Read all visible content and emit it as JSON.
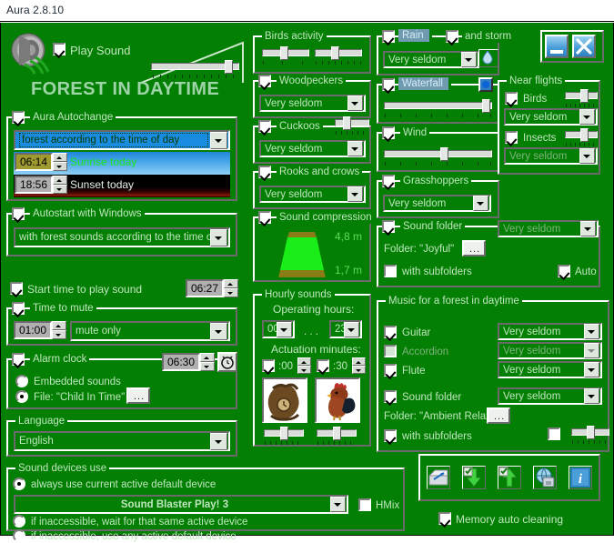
{
  "window": {
    "title": "Aura 2.8.10",
    "minimize_icon": "minimize-icon",
    "close_icon": "close-icon"
  },
  "header": {
    "play_sound_label": "Play Sound",
    "preset_title": "FOREST IN DAYTIME",
    "speaker_icon": "speaker-icon"
  },
  "aura_autochange": {
    "caption": "Aura Autochange",
    "mode_value": "forest according to the time of day",
    "sunrise_time": "06:14",
    "sunrise_label": "Sunrise today",
    "sunset_time": "18:56",
    "sunset_label": "Sunset today"
  },
  "autostart": {
    "caption": "Autostart with Windows",
    "value": "with forest sounds according to the time of day"
  },
  "start_time": {
    "label": "Start time to play sound",
    "value": "06:27"
  },
  "time_to_mute": {
    "caption": "Time to mute",
    "duration": "01:00",
    "mode": "mute only"
  },
  "alarm_clock": {
    "caption": "Alarm clock",
    "time": "06:30",
    "clock_icon": "alarm-clock-icon",
    "option_embedded": "Embedded sounds",
    "option_file": "File: \"Child In Time\"",
    "browse_icon": "browse-dots-icon"
  },
  "language": {
    "caption": "Language",
    "value": "English"
  },
  "sound_devices": {
    "caption": "Sound devices use",
    "option_always": "always use current active default device",
    "device": "Sound Blaster Play! 3",
    "hmix_label": "HMix",
    "option_wait": "if inaccessible, wait for that same active device",
    "option_any": "if inaccessible, use any active default device"
  },
  "birds_activity": {
    "caption": "Birds activity"
  },
  "woodpeckers": {
    "caption": "Woodpeckers",
    "value": "Very seldom"
  },
  "cuckoos": {
    "caption": "Cuckoos",
    "value": "Very seldom"
  },
  "rooks": {
    "caption": "Rooks and crows",
    "value": "Very seldom"
  },
  "sound_compression": {
    "caption": "Sound compression",
    "top_value": "4,8 m",
    "bottom_value": "1,7 m"
  },
  "hourly_sounds": {
    "caption": "Hourly sounds",
    "operating_hours_label": "Operating hours:",
    "hour_from": "00",
    "hours_sep": ". . .",
    "hour_to": "23",
    "actuation_label": "Actuation minutes:",
    "minute_00": ":00",
    "minute_30": ":30",
    "image_left": "cuckoo-clock-image",
    "image_right": "rooster-image"
  },
  "rain": {
    "caption": "Rain",
    "and_storm_label": "and storm",
    "value": "Very seldom",
    "drop_icon": "water-drop-icon"
  },
  "waterfall": {
    "caption": "Waterfall",
    "button_icon": "waterfall-dot-button"
  },
  "wind": {
    "caption": "Wind"
  },
  "grasshoppers": {
    "caption": "Grasshoppers",
    "value": "Very seldom"
  },
  "sound_folder_mid": {
    "caption": "Sound folder",
    "folder_label": "Folder: \"Joyful\"",
    "browse_icon": "browse-dots-icon",
    "subfolders_label": "with subfolders",
    "value": "Very seldom",
    "auto_label": "Auto"
  },
  "near_flights": {
    "caption": "Near flights",
    "birds_label": "Birds",
    "birds_value": "Very seldom",
    "insects_label": "Insects",
    "insects_value": "Very seldom"
  },
  "music": {
    "caption": "Music for a forest in daytime",
    "guitar_label": "Guitar",
    "guitar_value": "Very seldom",
    "accordion_label": "Accordion",
    "accordion_value": "Very seldom",
    "flute_label": "Flute",
    "flute_value": "Very seldom",
    "sound_folder_label": "Sound folder",
    "sound_folder_value": "Very seldom",
    "folder_label": "Folder: \"Ambient Relax\"",
    "browse_icon": "browse-dots-icon",
    "subfolders_label": "with subfolders"
  },
  "bottom_toolbar": {
    "icons": [
      "cleanup-icon",
      "download-icon",
      "upload-icon",
      "web-icon",
      "info-icon"
    ],
    "memory_label": "Memory auto cleaning"
  },
  "colors": {
    "background": "#038003",
    "text": "#bfe6bf",
    "text_dim": "#7fb27f",
    "highlight": "#6f9ab0",
    "accent_title": "#9fd4a8"
  }
}
